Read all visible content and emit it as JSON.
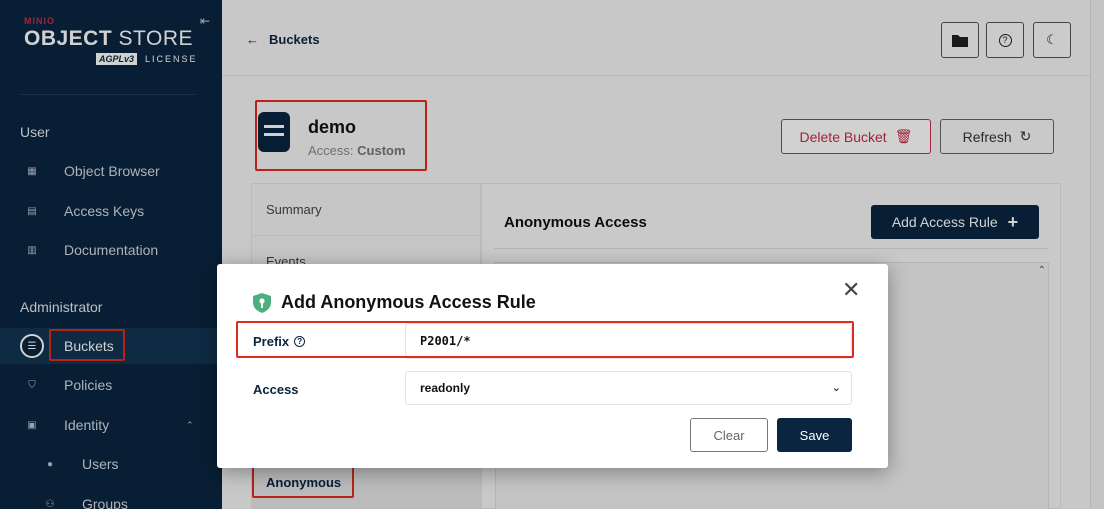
{
  "brand": {
    "minio": "MINIO",
    "object": "OBJECT",
    "store": "STORE",
    "agpl": "AGPLv3",
    "license": "LICENSE"
  },
  "sidebar": {
    "user_section": "User",
    "admin_section": "Administrator",
    "items": [
      {
        "label": "Object Browser",
        "icon": "object-browser-icon"
      },
      {
        "label": "Access Keys",
        "icon": "access-keys-icon"
      },
      {
        "label": "Documentation",
        "icon": "documentation-icon"
      },
      {
        "label": "Buckets",
        "icon": "bucket-icon",
        "active": true
      },
      {
        "label": "Policies",
        "icon": "policies-icon"
      },
      {
        "label": "Identity",
        "icon": "identity-icon"
      },
      {
        "label": "Users",
        "icon": "user-icon"
      },
      {
        "label": "Groups",
        "icon": "groups-icon"
      }
    ]
  },
  "header": {
    "back_label": "Buckets"
  },
  "bucket": {
    "name": "demo",
    "access_label": "Access:",
    "access_value": "Custom",
    "delete_label": "Delete Bucket",
    "refresh_label": "Refresh"
  },
  "tabs": [
    "Summary",
    "Events",
    "Anonymous"
  ],
  "content": {
    "title": "Anonymous Access",
    "add_rule_label": "Add Access Rule"
  },
  "modal": {
    "title": "Add Anonymous Access Rule",
    "prefix_label": "Prefix",
    "prefix_value": "P2001/*",
    "access_label": "Access",
    "access_value": "readonly",
    "clear_label": "Clear",
    "save_label": "Save"
  },
  "colors": {
    "navy": "#0a2540",
    "danger": "#c72c48",
    "shield": "#4caf7d",
    "highlight": "#e02b20"
  }
}
